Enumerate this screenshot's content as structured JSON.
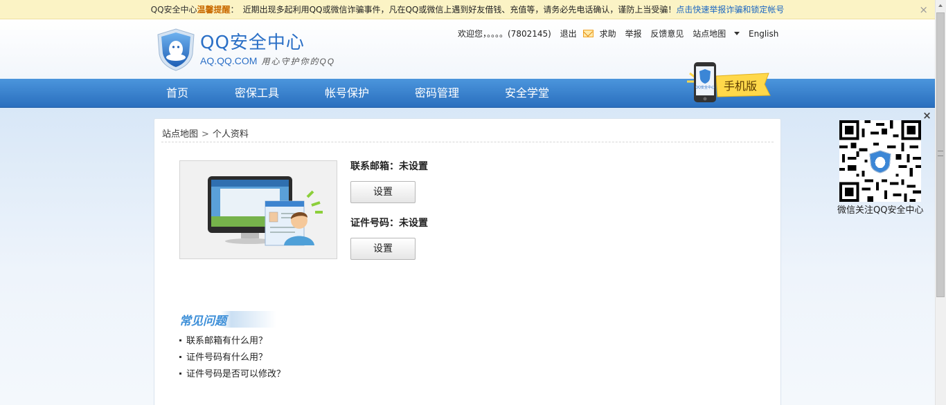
{
  "notice": {
    "title_prefix": "QQ安全中心",
    "title_bold": "温馨提醒",
    "title_suffix": "：",
    "message": "近期出现多起利用QQ或微信诈骗事件，凡在QQ或微信上遇到好友借钱、充值等，请务必先电话确认，谨防上当受骗！",
    "link": "点击快速举报诈骗和锁定帐号",
    "close": "×"
  },
  "header": {
    "logo_title": "QQ安全中心",
    "logo_url": "AQ.QQ.COM",
    "slogan": "用心守护你的QQ",
    "welcome": "欢迎您，。。。。(7802145)",
    "logout": "退出",
    "help": "求助",
    "report": "举报",
    "feedback": "反馈意见",
    "sitemap": "站点地图",
    "english": "English",
    "mobile_badge": "手机版",
    "mobile_screen_text": "QQ安全中心"
  },
  "nav": {
    "items": [
      "首页",
      "密保工具",
      "帐号保护",
      "密码管理",
      "安全学堂"
    ]
  },
  "breadcrumb": {
    "root": "站点地图",
    "separator": ">",
    "current": "个人资料"
  },
  "profile": {
    "email_label": "联系邮箱：未设置",
    "email_button": "设置",
    "id_label": "证件号码：未设置",
    "id_button": "设置"
  },
  "faq": {
    "title": "常见问题",
    "items": [
      "联系邮箱有什么用？",
      "证件号码有什么用？",
      "证件号码是否可以修改？"
    ]
  },
  "qr": {
    "close": "×",
    "caption": "微信关注QQ安全中心"
  },
  "colors": {
    "nav_blue": "#2a6fbe",
    "brand_blue": "#2a6fc6",
    "notice_bg": "#fbf3c5",
    "notice_highlight": "#c96a00",
    "link_blue": "#1a66c2"
  }
}
